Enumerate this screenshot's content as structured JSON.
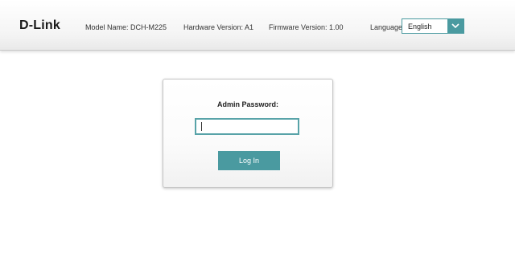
{
  "header": {
    "logo": "D-Link",
    "model": "Model Name: DCH-M225",
    "hardware": "Hardware Version: A1",
    "firmware": "Firmware Version: 1.00",
    "language_label": "Language:",
    "language_value": "English",
    "language_arrow_icon": "chevron-down-icon"
  },
  "login": {
    "title": "Admin Password:",
    "password_value": "",
    "button_label": "Log In"
  },
  "colors": {
    "accent": "#4a9aa0"
  }
}
